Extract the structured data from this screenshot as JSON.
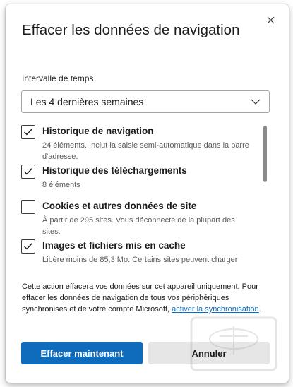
{
  "dialog": {
    "title": "Effacer les données de navigation",
    "close_icon": "close-icon"
  },
  "time_range": {
    "label": "Intervalle de temps",
    "selected": "Les 4 dernières semaines"
  },
  "items": [
    {
      "title": "Historique de navigation",
      "description": "24 éléments. Inclut la saisie semi-automatique dans la barre d'adresse.",
      "checked": true
    },
    {
      "title": "Historique des téléchargements",
      "description": "8 éléments",
      "checked": true
    },
    {
      "title": "Cookies et autres données de site",
      "description": "À partir de 295 sites. Vous déconnecte de la plupart des sites.",
      "checked": false
    },
    {
      "title": "Images et fichiers mis en cache",
      "description": "Libère moins de 85,3 Mo. Certains sites peuvent charger",
      "checked": true
    }
  ],
  "info": {
    "text": "Cette action effacera vos données sur cet appareil uniquement. Pour effacer les données de navigation de tous vos périphériques synchronisés et de votre compte Microsoft, ",
    "link": "activer la synchronisation",
    "end": "."
  },
  "buttons": {
    "primary": "Effacer maintenant",
    "secondary": "Annuler"
  },
  "colors": {
    "accent": "#0f6cbd"
  }
}
